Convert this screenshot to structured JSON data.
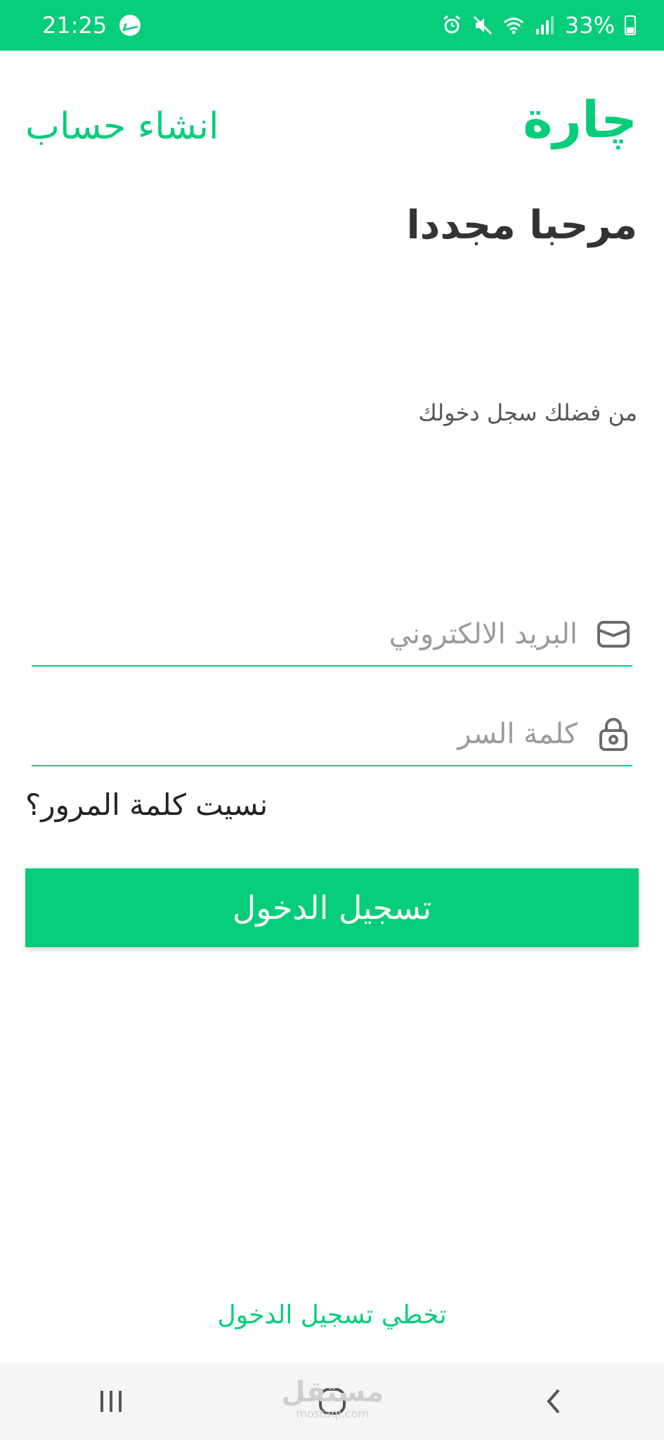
{
  "status_bar": {
    "time": "21:25",
    "battery": "33%",
    "left_icons": [
      "messenger-icon"
    ],
    "right_icons": [
      "alarm-icon",
      "mute-icon",
      "wifi-icon",
      "signal-icon",
      "battery-icon"
    ]
  },
  "header": {
    "logo": "چارة",
    "create_account": "انشاء حساب"
  },
  "welcome": "مرحبا مجددا",
  "subtitle": "من فضلك سجل دخولك",
  "form": {
    "email_placeholder": "البريد الالكتروني",
    "email_value": "",
    "email_icon": "envelope-icon",
    "password_placeholder": "كلمة السر",
    "password_value": "",
    "password_icon": "lock-icon",
    "forgot_password": "نسيت كلمة المرور؟",
    "login_button": "تسجيل الدخول"
  },
  "skip_login": "تخطي تسجيل الدخول",
  "nav_bar": {
    "buttons": [
      "recent-apps-icon",
      "home-icon",
      "back-icon"
    ]
  },
  "watermark": {
    "text": "مستقل",
    "subtext": "mostaql.com"
  },
  "colors": {
    "accent": "#06cd7a",
    "text_dark": "#333333",
    "placeholder": "#9a9a9a"
  }
}
